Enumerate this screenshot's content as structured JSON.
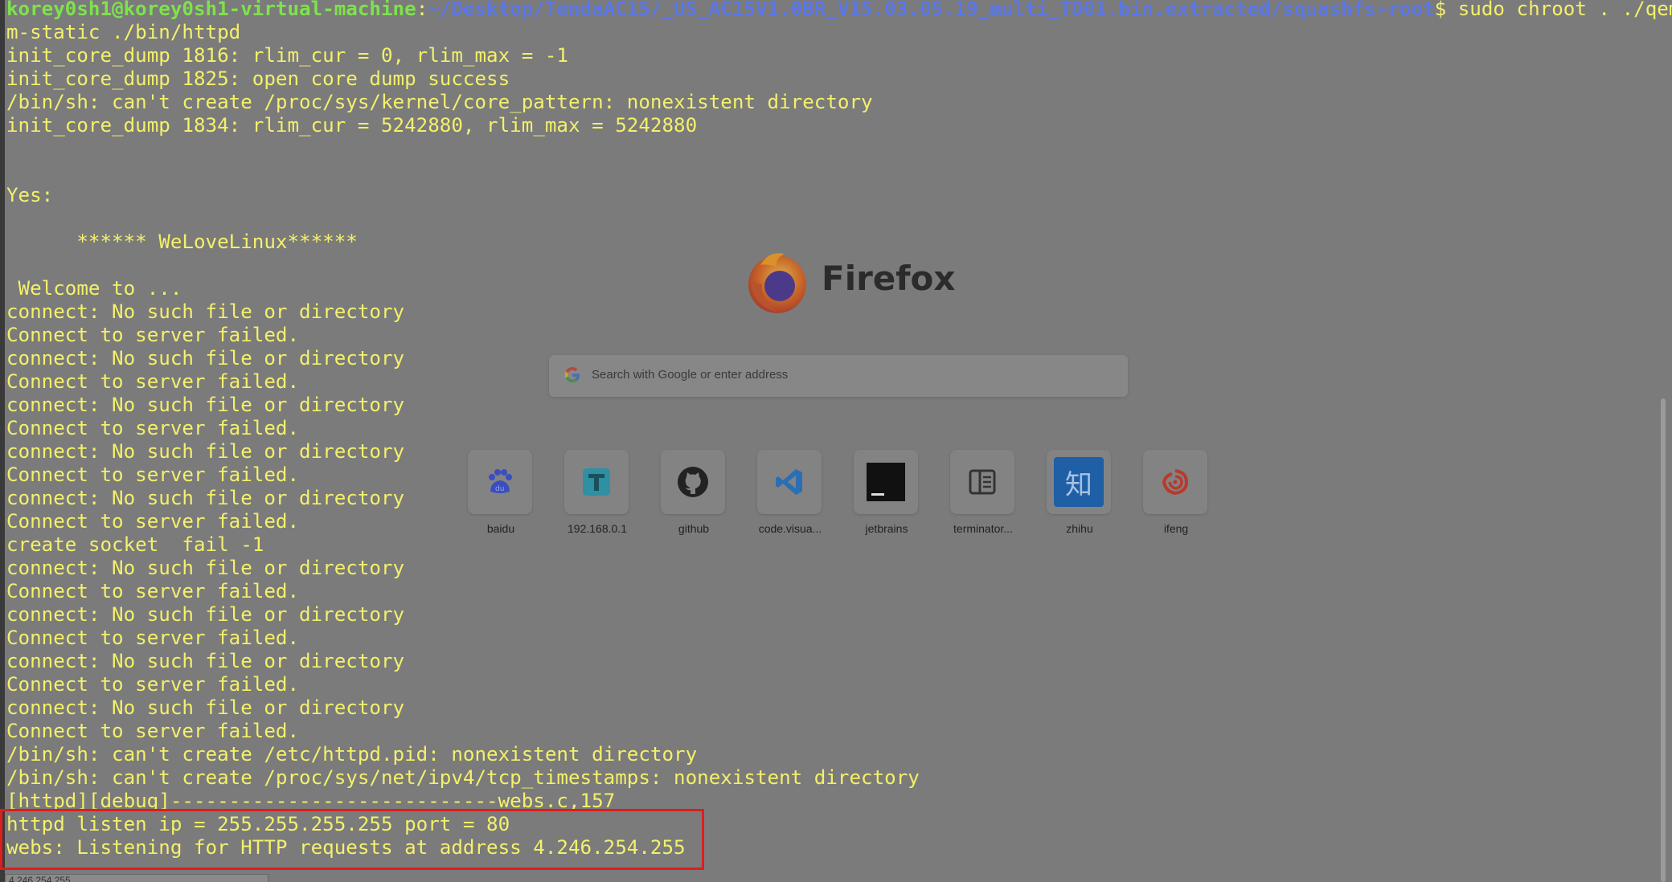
{
  "terminal": {
    "prompt": {
      "user_host": "korey0sh1@korey0sh1-virtual-machine",
      "colon": ":",
      "path": "~/Desktop/TendaAC15/_US_AC15V1.0BR_V15.03.05.19_multi_TD01.bin.extracted/squashfs-root",
      "command": "$ sudo chroot . ./qemu-ar"
    },
    "lines": [
      "m-static ./bin/httpd",
      "init_core_dump 1816: rlim_cur = 0, rlim_max = -1",
      "init_core_dump 1825: open core dump success",
      "/bin/sh: can't create /proc/sys/kernel/core_pattern: nonexistent directory",
      "init_core_dump 1834: rlim_cur = 5242880, rlim_max = 5242880",
      "",
      "",
      "Yes:",
      "",
      "      ****** WeLoveLinux******",
      "",
      " Welcome to ...",
      "connect: No such file or directory",
      "Connect to server failed.",
      "connect: No such file or directory",
      "Connect to server failed.",
      "connect: No such file or directory",
      "Connect to server failed.",
      "connect: No such file or directory",
      "Connect to server failed.",
      "connect: No such file or directory",
      "Connect to server failed.",
      "create socket  fail -1",
      "connect: No such file or directory",
      "Connect to server failed.",
      "connect: No such file or directory",
      "Connect to server failed.",
      "connect: No such file or directory",
      "Connect to server failed.",
      "connect: No such file or directory",
      "Connect to server failed.",
      "/bin/sh: can't create /etc/httpd.pid: nonexistent directory",
      "/bin/sh: can't create /proc/sys/net/ipv4/tcp_timestamps: nonexistent directory",
      "[httpd][debug]----------------------------webs.c,157",
      "httpd listen ip = 255.255.255.255 port = 80",
      "webs: Listening for HTTP requests at address 4.246.254.255"
    ]
  },
  "browser": {
    "wordmark": "Firefox",
    "search_placeholder": "Search with Google or enter address",
    "shortcuts": [
      {
        "label": "baidu",
        "icon": "baidu-paw-icon"
      },
      {
        "label": "192.168.0.1",
        "icon": "t-letter-icon"
      },
      {
        "label": "github",
        "icon": "github-icon"
      },
      {
        "label": "code.visua...",
        "icon": "vscode-icon"
      },
      {
        "label": "jetbrains",
        "icon": "jetbrains-icon"
      },
      {
        "label": "terminator...",
        "icon": "terminator-icon"
      },
      {
        "label": "zhihu",
        "icon": "zhihu-icon"
      },
      {
        "label": "ifeng",
        "icon": "ifeng-icon"
      }
    ],
    "zhihu_glyph": "知",
    "status_url": "4.246.254.255"
  },
  "colors": {
    "terminal_text": "#f3f06b",
    "prompt_user": "#7ee24b",
    "prompt_path": "#5b77e6",
    "highlight_box": "#e01d1d"
  }
}
